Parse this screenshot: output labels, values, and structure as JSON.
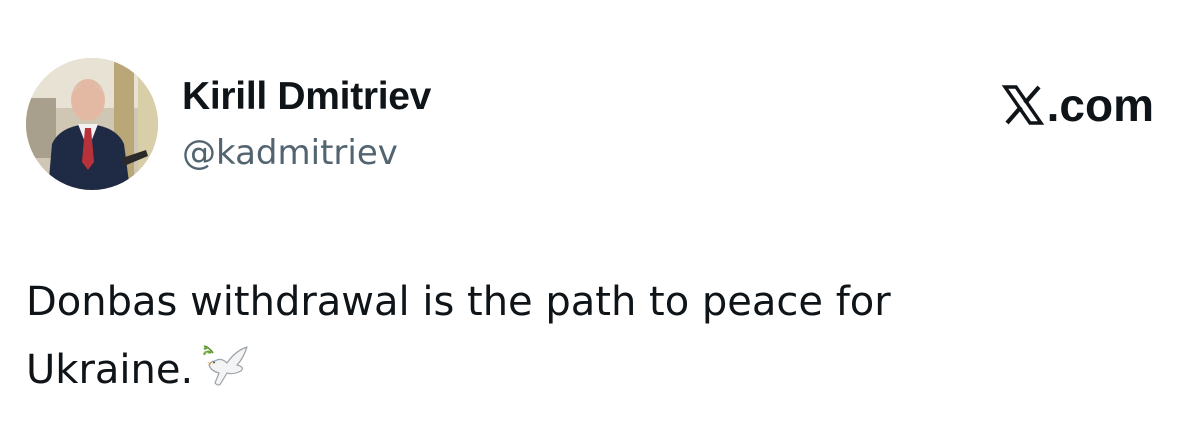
{
  "author": {
    "display_name": "Kirill Dmitriev",
    "handle": "@kadmitriev"
  },
  "brand": {
    "x_symbol": "𝕏",
    "domain_text": ".com"
  },
  "post": {
    "line1": "Donbas withdrawal is the path to peace for",
    "line2": "Ukraine.",
    "emoji_icon": "dove-with-olive-branch-icon"
  },
  "colors": {
    "primary_text": "#0f1419",
    "secondary_text": "#536471",
    "background": "#ffffff"
  }
}
